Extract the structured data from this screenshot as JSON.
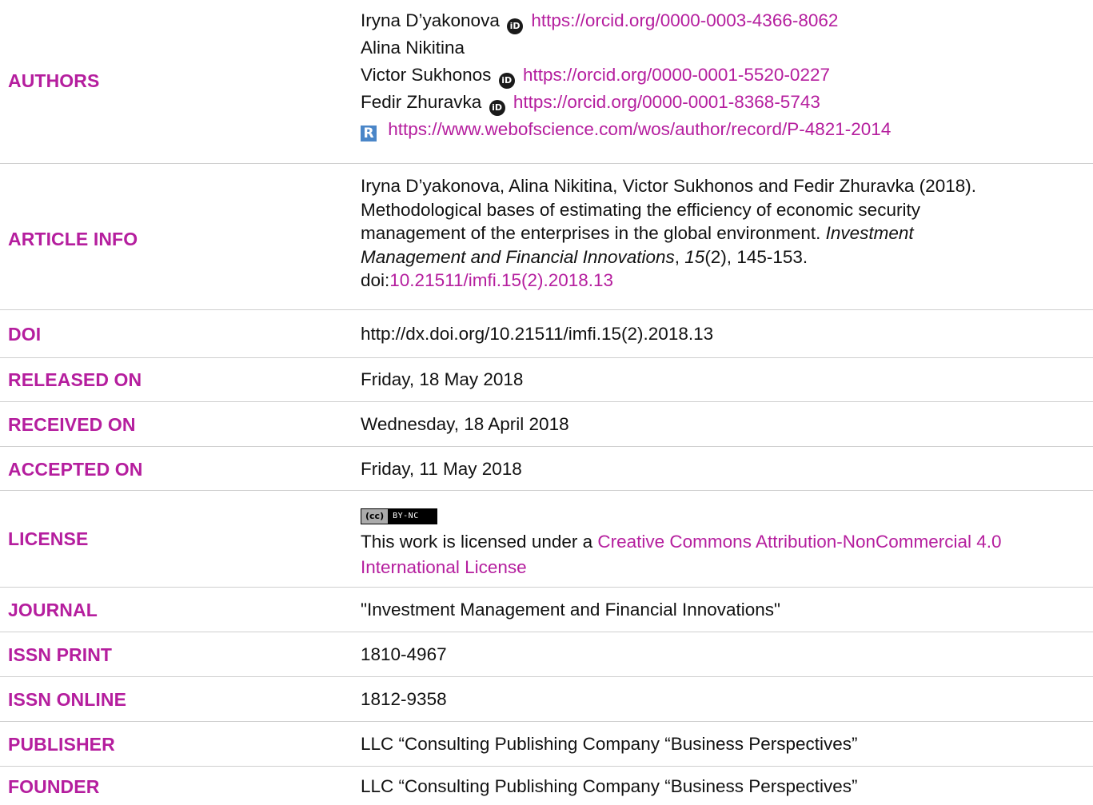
{
  "rows": {
    "authors": {
      "label": "AUTHORS",
      "a1_name": "Iryna D’yakonova",
      "a1_orcid": "https://orcid.org/0000-0003-4366-8062",
      "a2_name": "Alina Nikitina",
      "a3_name": "Victor Sukhonos",
      "a3_orcid": "https://orcid.org/0000-0001-5520-0227",
      "a4_name": "Fedir Zhuravka",
      "a4_orcid": "https://orcid.org/0000-0001-8368-5743",
      "a4_researcherid": "https://www.webofscience.com/wos/author/record/P-4821-2014",
      "orcid_icon": "iD",
      "researcherid_icon": "R"
    },
    "article_info": {
      "label": "ARTICLE INFO",
      "line1": "Iryna D’yakonova, Alina Nikitina, Victor Sukhonos and Fedir Zhuravka (2018).",
      "line2": "Methodological bases of estimating the efficiency of economic security",
      "line3a": "management of the enterprises in the global environment. ",
      "line3b": "Investment",
      "line4a": "Management and Financial Innovations",
      "line4b": ", ",
      "line4c": "15",
      "line4d": "(2), 145-153.",
      "line5a": "doi:",
      "line5b": "10.21511/imfi.15(2).2018.13"
    },
    "doi": {
      "label": "DOI",
      "value": "http://dx.doi.org/10.21511/imfi.15(2).2018.13"
    },
    "released": {
      "label": "RELEASED ON",
      "value": "Friday, 18 May 2018"
    },
    "received": {
      "label": "RECEIVED ON",
      "value": "Wednesday, 18 April 2018"
    },
    "accepted": {
      "label": "ACCEPTED ON",
      "value": "Friday, 11 May 2018"
    },
    "license": {
      "label": "LICENSE",
      "badge_left": "(cc)",
      "badge_right": "BY-NC",
      "text_a": "This work is licensed under a ",
      "link_a": "Creative Commons Attribution-NonCommercial 4.0",
      "link_b": "International License"
    },
    "journal": {
      "label": "JOURNAL",
      "value": "\"Investment Management and Financial Innovations\""
    },
    "issn_print": {
      "label": "ISSN PRINT",
      "value": "1810-4967"
    },
    "issn_online": {
      "label": "ISSN ONLINE",
      "value": "1812-9358"
    },
    "publisher": {
      "label": "PUBLISHER",
      "value": "LLC “Consulting Publishing Company “Business Perspectives”"
    },
    "founder": {
      "label": "FOUNDER",
      "value": "LLC “Consulting Publishing Company “Business Perspectives”"
    }
  },
  "colors": {
    "label": "#b51e9e",
    "link": "#b51e9e",
    "divider": "#cfcfcf",
    "text": "#111111"
  }
}
